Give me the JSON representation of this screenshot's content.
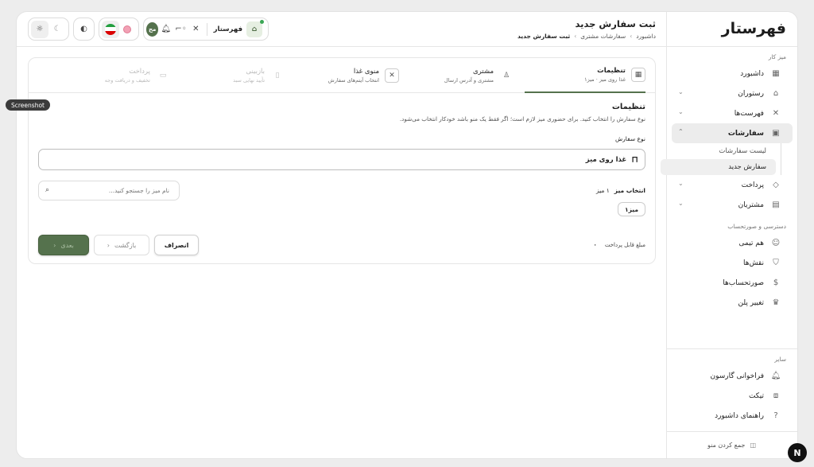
{
  "brand": {
    "logo_text": "فهرستار",
    "accent": "#55724d"
  },
  "header": {
    "title": "ثبت سفارش جدید",
    "breadcrumb": [
      "داشبورد",
      "سفارشات مشتری",
      "ثبت سفارش جدید"
    ],
    "store_name": "فهرستار",
    "avatar_initials": "مح"
  },
  "sidebar": {
    "workspace_label": "میز کار",
    "items": [
      {
        "label": "داشبورد",
        "icon": "grid-icon"
      },
      {
        "label": "رستوران",
        "icon": "store-icon"
      },
      {
        "label": "فهرست‌ها",
        "icon": "utensils-icon"
      },
      {
        "label": "سفارشات",
        "icon": "bag-icon"
      },
      {
        "label": "پرداخت",
        "icon": "tag-icon"
      },
      {
        "label": "مشتریان",
        "icon": "contact-icon"
      }
    ],
    "orders_sub": [
      "لیست سفارشات",
      "سفارش جدید"
    ],
    "access_label": "دسترسی و صورتحساب",
    "access_items": [
      {
        "label": "هم تیمی",
        "icon": "users-icon"
      },
      {
        "label": "نقش‌ها",
        "icon": "shield-icon"
      },
      {
        "label": "صورتحساب‌ها",
        "icon": "invoice-icon"
      },
      {
        "label": "تغییر پلن",
        "icon": "crown-icon"
      }
    ],
    "other_label": "سایر",
    "other_items": [
      {
        "label": "فراخوانی گارسون",
        "icon": "bell-icon"
      },
      {
        "label": "تیکت",
        "icon": "ticket-icon"
      },
      {
        "label": "راهنمای داشبورد",
        "icon": "help-icon"
      }
    ],
    "collapse_label": "جمع کردن منو"
  },
  "steps": [
    {
      "label": "تنظیمات",
      "desc": "غذا روی میز · میز۱"
    },
    {
      "label": "مشتری",
      "desc": "مشتری و آدرس ارسال"
    },
    {
      "label": "منوی غذا",
      "desc": "انتخاب آیتم‌های سفارش"
    },
    {
      "label": "بازبینی",
      "desc": "تأیید نهایی سبد"
    },
    {
      "label": "پرداخت",
      "desc": "تخفیف و دریافت وجه"
    }
  ],
  "settings": {
    "title": "تنظیمات",
    "desc": "نوع سفارش را انتخاب کنید. برای حضوری میز لازم است؛ اگر فقط یک منو باشد خودکار انتخاب می‌شود.",
    "type_label": "نوع سفارش",
    "type_value": "غذا روی میز",
    "search_placeholder": "نام میز را جستجو کنید...",
    "table_select_label": "انتخاب میز",
    "table_count": "۱ میز",
    "table_chip": "میز۱"
  },
  "footer": {
    "payable_label": "مبلغ قابل پرداخت",
    "payable_value": "۰",
    "cancel": "انصراف",
    "back": "بازگشت",
    "next": "بعدی"
  },
  "overlay": {
    "screenshot_label": "Screenshot",
    "badge": "N"
  }
}
